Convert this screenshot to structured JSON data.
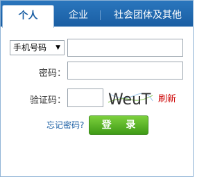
{
  "tabs": {
    "personal": "个人",
    "enterprise": "企业",
    "social": "社会团体及其他"
  },
  "form": {
    "account_type_selected": "手机号码",
    "phone_value": "",
    "password_label": "密码：",
    "password_value": "",
    "captcha_label": "验证码：",
    "captcha_value": "",
    "captcha_text": "WeuT",
    "refresh_label": "刷新",
    "forgot_label": "忘记密码?",
    "login_label": "登 录"
  },
  "colors": {
    "tab_bar": "#1f68b0",
    "login_button": "#4fae22",
    "refresh_link": "#cc0000",
    "forgot_link": "#1a5ea3"
  }
}
